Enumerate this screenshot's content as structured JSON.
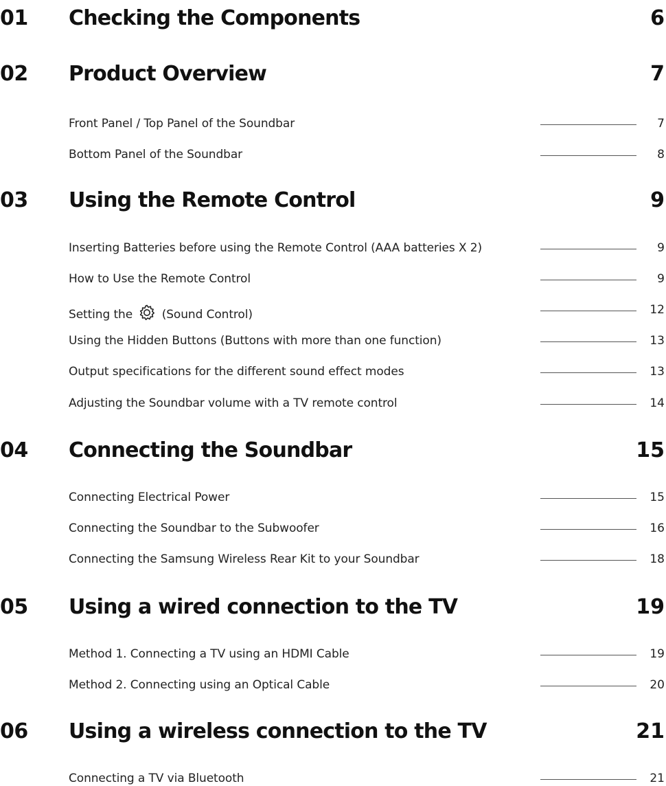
{
  "toc": {
    "sections": [
      {
        "number": "01",
        "title": "Checking the Components",
        "page": "6",
        "items": []
      },
      {
        "number": "02",
        "title": "Product Overview",
        "page": "7",
        "items": [
          {
            "title": "Front Panel / Top Panel of the Soundbar",
            "page": "7"
          },
          {
            "title": "Bottom Panel of the Soundbar",
            "page": "8"
          }
        ]
      },
      {
        "number": "03",
        "title": "Using the Remote Control",
        "page": "9",
        "items": [
          {
            "title": "Inserting Batteries before using the Remote Control (AAA batteries X 2)",
            "page": "9"
          },
          {
            "title": "How to Use the Remote Control",
            "page": "9"
          },
          {
            "title_before": "Setting the",
            "title_after": "(Sound Control)",
            "icon": "gear-icon",
            "page": "12"
          },
          {
            "title": "Using the Hidden Buttons (Buttons with more than one function)",
            "page": "13"
          },
          {
            "title": "Output specifications for the different sound effect modes",
            "page": "13"
          },
          {
            "title": "Adjusting the Soundbar volume with a TV remote control",
            "page": "14"
          }
        ]
      },
      {
        "number": "04",
        "title": "Connecting the Soundbar",
        "page": "15",
        "items": [
          {
            "title": "Connecting Electrical Power",
            "page": "15"
          },
          {
            "title": "Connecting the Soundbar to the Subwoofer",
            "page": "16"
          },
          {
            "title": "Connecting the Samsung Wireless Rear Kit to your Soundbar",
            "page": "18"
          }
        ]
      },
      {
        "number": "05",
        "title": "Using a wired connection to the TV",
        "page": "19",
        "items": [
          {
            "title": "Method 1. Connecting a TV using an HDMI Cable",
            "page": "19"
          },
          {
            "title": "Method 2. Connecting using an Optical Cable",
            "page": "20"
          }
        ]
      },
      {
        "number": "06",
        "title": "Using a wireless connection to the TV",
        "page": "21",
        "items": [
          {
            "title": "Connecting a TV via Bluetooth",
            "page": "21"
          }
        ]
      }
    ]
  }
}
